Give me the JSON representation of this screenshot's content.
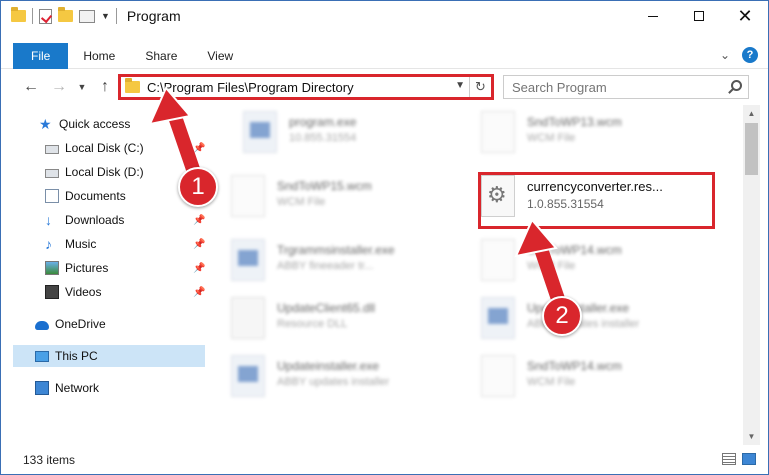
{
  "window": {
    "title": "Program",
    "controls": {
      "minimize": "—",
      "maximize": "",
      "close": "✕"
    }
  },
  "ribbon": {
    "tabs": [
      "File",
      "Home",
      "Share",
      "View"
    ],
    "help": "?"
  },
  "nav": {
    "address": "C:\\Program Files\\Program Directory",
    "search_placeholder": "Search Program"
  },
  "sidebar": {
    "items": [
      {
        "label": "Quick access",
        "icon": "star-icon"
      },
      {
        "label": "Local Disk (C:)",
        "icon": "drive-icon"
      },
      {
        "label": "Local Disk (D:)",
        "icon": "drive-icon"
      },
      {
        "label": "Documents",
        "icon": "documents-icon"
      },
      {
        "label": "Downloads",
        "icon": "download-icon"
      },
      {
        "label": "Music",
        "icon": "music-icon"
      },
      {
        "label": "Pictures",
        "icon": "pictures-icon"
      },
      {
        "label": "Videos",
        "icon": "videos-icon"
      },
      {
        "label": "OneDrive",
        "icon": "cloud-icon"
      },
      {
        "label": "This PC",
        "icon": "computer-icon"
      },
      {
        "label": "Network",
        "icon": "network-icon"
      }
    ]
  },
  "files": [
    {
      "name": "program.exe",
      "sub": "10.855.31554",
      "type": "exe"
    },
    {
      "name": "SndToWP13.wcm",
      "sub": "WCM File",
      "type": "doc"
    },
    {
      "name": "SndToWP15.wcm",
      "sub": "WCM File",
      "type": "doc"
    },
    {
      "name": "currencyconverter.res...",
      "sub": "1.0.855.31554",
      "type": "gear"
    },
    {
      "name": "Trgrammsinstaller.exe",
      "sub": "ABBY fineeader tr...",
      "type": "exe"
    },
    {
      "name": "SndToWP14.wcm",
      "sub": "WCM File",
      "type": "doc"
    },
    {
      "name": "UpdateClient65.dll",
      "sub": "Resource DLL",
      "type": "dll"
    },
    {
      "name": "Updateinstaller.exe",
      "sub": "ABBY updates installer",
      "type": "exe"
    },
    {
      "name": "Updateinstaller.exe",
      "sub": "ABBY updates installer",
      "type": "exe"
    },
    {
      "name": "SndToWP14.wcm",
      "sub": "WCM File",
      "type": "doc"
    }
  ],
  "status": {
    "count": "133 items"
  },
  "annotations": {
    "step1": "1",
    "step2": "2",
    "color": "#d9262c"
  }
}
